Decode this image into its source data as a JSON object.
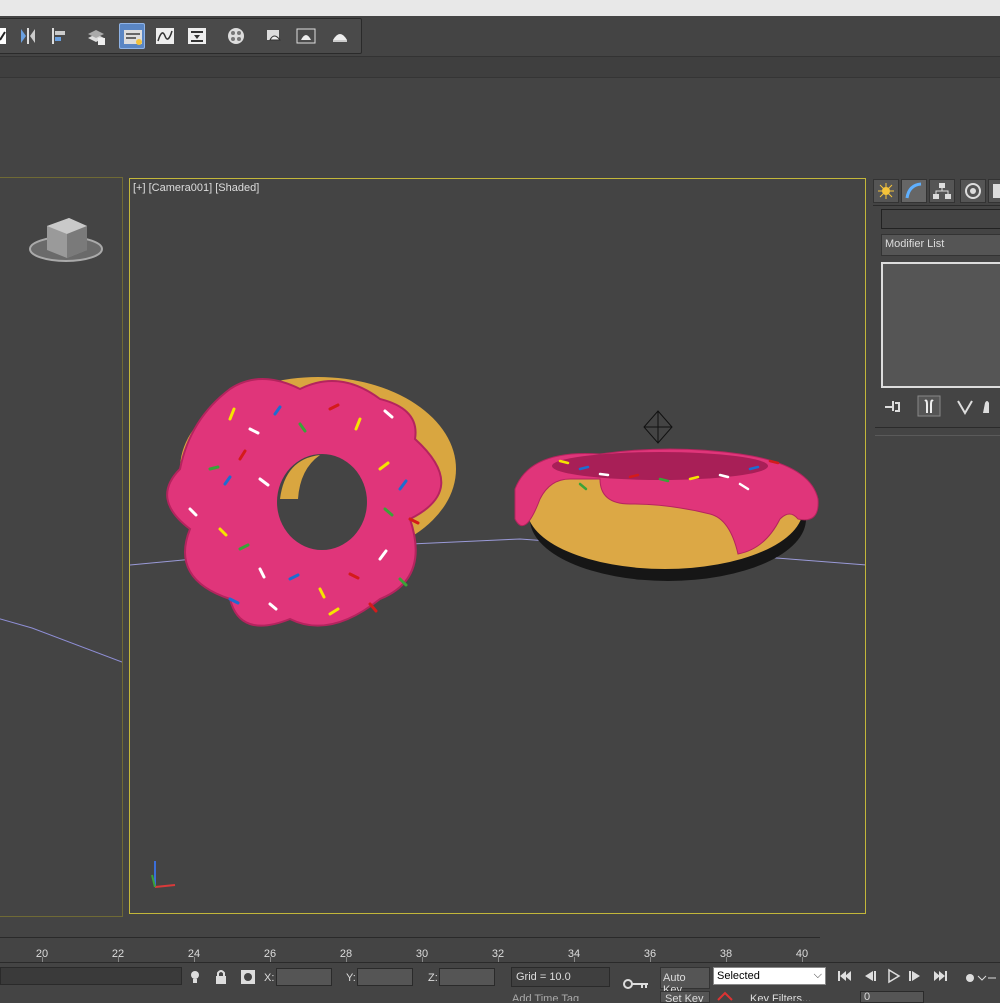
{
  "viewport": {
    "label": "[+] [Camera001] [Shaded]"
  },
  "command_panel": {
    "name_value": "",
    "modifier_list_label": "Modifier List"
  },
  "timeline": {
    "ticks": [
      "20",
      "22",
      "24",
      "26",
      "28",
      "30",
      "32",
      "34",
      "36",
      "38",
      "40"
    ]
  },
  "status_bar": {
    "x_label": "X:",
    "y_label": "Y:",
    "z_label": "Z:",
    "x_value": "",
    "y_value": "",
    "z_value": "",
    "grid": "Grid = 10.0",
    "auto_key": "Auto Key",
    "set_key": "Set Key",
    "selected": "Selected",
    "key_filters": "Key Filters...",
    "add_time_tag": "Add Time Tag",
    "frame_value": "0"
  },
  "colors": {
    "viewport_active_border": "#c3b73a",
    "frosting": "#e0357a",
    "dough": "#e4b24a",
    "accent": "#5a86c4"
  },
  "icons": {
    "toolbar": [
      "select-icon",
      "mirror-icon",
      "align-icon",
      "layer-manager-icon",
      "scene-explorer-icon",
      "curve-editor-icon",
      "schematic-view-icon",
      "material-editor-icon",
      "render-setup-icon",
      "rendered-frame-icon",
      "render-icon",
      "render-iterative-icon"
    ],
    "command_tabs": [
      "create-icon",
      "modify-icon",
      "hierarchy-icon",
      "motion-icon",
      "display-icon"
    ]
  }
}
